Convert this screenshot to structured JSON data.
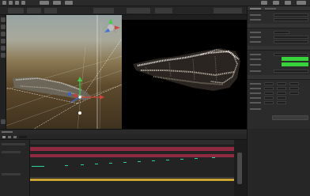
{
  "colors": {
    "accent_green": "#36d33b",
    "keyframe": "#2ecfa2",
    "track_red": "#8f2a40",
    "track_yellow": "#c9a434",
    "gizmo_y": "#3fd04a",
    "gizmo_x": "#d0453c",
    "gizmo_z": "#3e6ee0"
  },
  "icons": {
    "scene_gizmo": "axis-gizmo-icon",
    "move_tool": "move-tool-icon",
    "play": "play-icon"
  }
}
